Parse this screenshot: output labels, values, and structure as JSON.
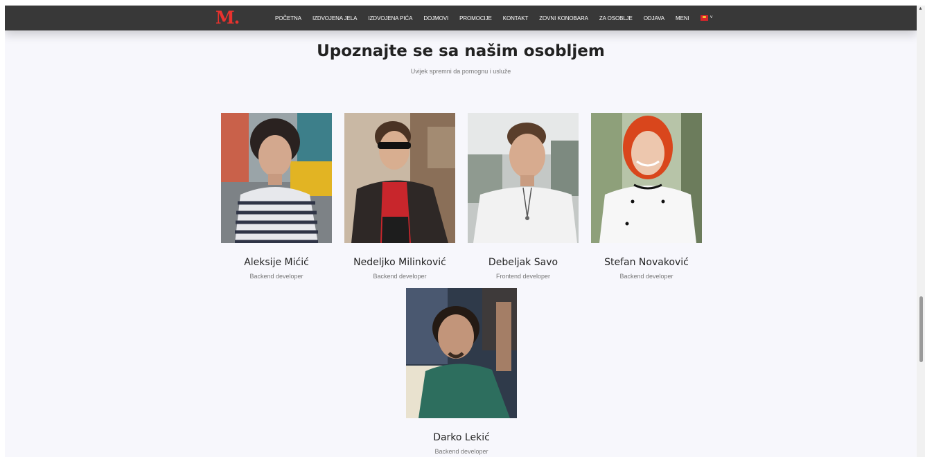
{
  "brand": {
    "logo": "M."
  },
  "nav": {
    "items": [
      {
        "label": "Početna"
      },
      {
        "label": "Izdvojena jela"
      },
      {
        "label": "Izdvojena pića"
      },
      {
        "label": "Dojmovi"
      },
      {
        "label": "Promocije"
      },
      {
        "label": "Kontakt"
      },
      {
        "label": "Zovni konobara"
      },
      {
        "label": "Za osoblje"
      },
      {
        "label": "Odjava"
      },
      {
        "label": "Meni"
      }
    ],
    "language_icon": "flag-icon",
    "language_chevron": "˅"
  },
  "section": {
    "title": "Upoznajte se sa našim osobljem",
    "subtitle": "Uvijek spremni da pomognu i usluže"
  },
  "staff": [
    {
      "name": "Aleksije Mićić",
      "role": "Backend developer"
    },
    {
      "name": "Nedeljko Milinković",
      "role": "Backend developer"
    },
    {
      "name": "Debeljak Savo",
      "role": "Frontend developer"
    },
    {
      "name": "Stefan Novaković",
      "role": "Backend developer"
    },
    {
      "name": "Darko Lekić",
      "role": "Backend developer"
    }
  ],
  "colors": {
    "navbar": "#383838",
    "brand_red": "#e8322e",
    "page_bg": "#f7f7fc",
    "heading": "#222222",
    "muted": "#777777"
  }
}
